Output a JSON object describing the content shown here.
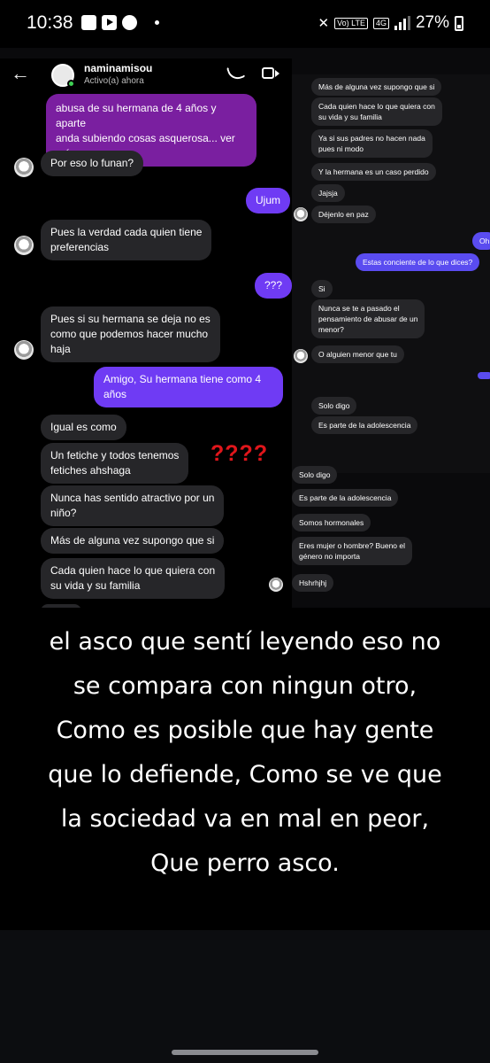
{
  "status_bar": {
    "time": "10:38",
    "network": "4G",
    "volte": "Vo) LTE",
    "battery": "27%"
  },
  "chat": {
    "username": "naminamisou",
    "status": "Activo(a) ahora",
    "left_messages": [
      {
        "text": "abusa de su hermana de 4 años y aparte\nanda subiendo cosas asquerosa... ver más",
        "style": "purple"
      },
      {
        "text": "Por eso lo funan?",
        "style": "them"
      },
      {
        "text": "Ujum",
        "style": "me"
      },
      {
        "text": "Pues la verdad cada quien tiene\npreferencias",
        "style": "them"
      },
      {
        "text": "???",
        "style": "me"
      },
      {
        "text": "Pues si su hermana se deja no es\ncomo que podemos hacer mucho\nhaja",
        "style": "them"
      },
      {
        "text": "Amigo, Su hermana tiene como 4\naños",
        "style": "me"
      },
      {
        "text": "Igual es como",
        "style": "them"
      },
      {
        "text": "Un fetiche y todos tenemos\nfetiches ahshaga",
        "style": "them"
      },
      {
        "text": "Nunca has sentido atractivo por un\nniño?",
        "style": "them"
      },
      {
        "text": "Más de alguna vez supongo que si",
        "style": "them"
      },
      {
        "text": "Cada quien hace lo que quiera con\nsu vida y su familia",
        "style": "them"
      }
    ],
    "annotation": "????",
    "right_messages": [
      {
        "text": "Más de alguna vez supongo que si",
        "style": "them"
      },
      {
        "text": "Cada quien hace lo que quiera con\nsu vida y su familia",
        "style": "them"
      },
      {
        "text": "Ya si sus padres no hacen nada\npues ni modo",
        "style": "them"
      },
      {
        "text": "Y la hermana es un caso perdido",
        "style": "them"
      },
      {
        "text": "Jajsja",
        "style": "them"
      },
      {
        "text": "Déjenlo en paz",
        "style": "them"
      },
      {
        "text": "Oh",
        "style": "me"
      },
      {
        "text": "Estas conciente de lo que dices?",
        "style": "me"
      },
      {
        "text": "Si",
        "style": "them"
      },
      {
        "text": "Nunca se te a pasado el\npensamiento de abusar de un\nmenor?",
        "style": "them"
      },
      {
        "text": "O alguien menor que tu",
        "style": "them"
      },
      {
        "text": "Solo digo",
        "style": "them"
      },
      {
        "text": "Es parte de la adolescencia",
        "style": "them"
      }
    ],
    "right_lower_messages": [
      {
        "text": "Solo digo"
      },
      {
        "text": "Es parte de la adolescencia"
      },
      {
        "text": "Somos hormonales"
      },
      {
        "text": "Eres mujer o hombre? Bueno el\ngénero no importa"
      },
      {
        "text": "Hshrhjhj"
      }
    ]
  },
  "caption": "el asco que sentí leyendo eso no\nse compara con ningun otro,\nComo es posible que hay gente\nque lo defiende, Como se ve que\nla sociedad va en mal en peor,\nQue perro asco."
}
